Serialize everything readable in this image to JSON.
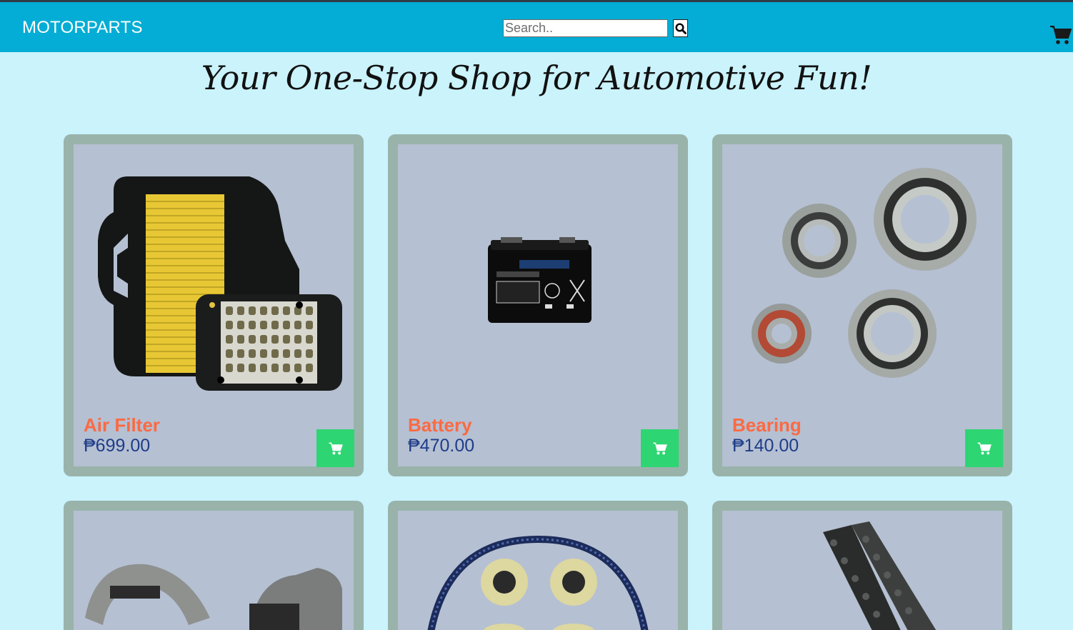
{
  "brand": "MOTORPARTS",
  "search": {
    "placeholder": "Search.."
  },
  "headline": "Your One-Stop Shop for Automotive Fun!",
  "currency": "₱",
  "products": [
    {
      "name": "Air Filter",
      "price": "₱699.00"
    },
    {
      "name": "Battery",
      "price": "₱470.00"
    },
    {
      "name": "Bearing",
      "price": "₱140.00"
    },
    {
      "name": "",
      "price": ""
    },
    {
      "name": "",
      "price": ""
    },
    {
      "name": "",
      "price": ""
    }
  ],
  "colors": {
    "header": "#04add5",
    "background": "#caf3fc",
    "card_frame": "#99b3ab",
    "card_body": "#b5c0d2",
    "product_name": "#fb6a43",
    "price": "#1f3d8a",
    "add_button": "#2ed573"
  },
  "icons": {
    "search": "search-icon",
    "cart": "cart-icon",
    "add_to_cart": "cart-icon"
  }
}
